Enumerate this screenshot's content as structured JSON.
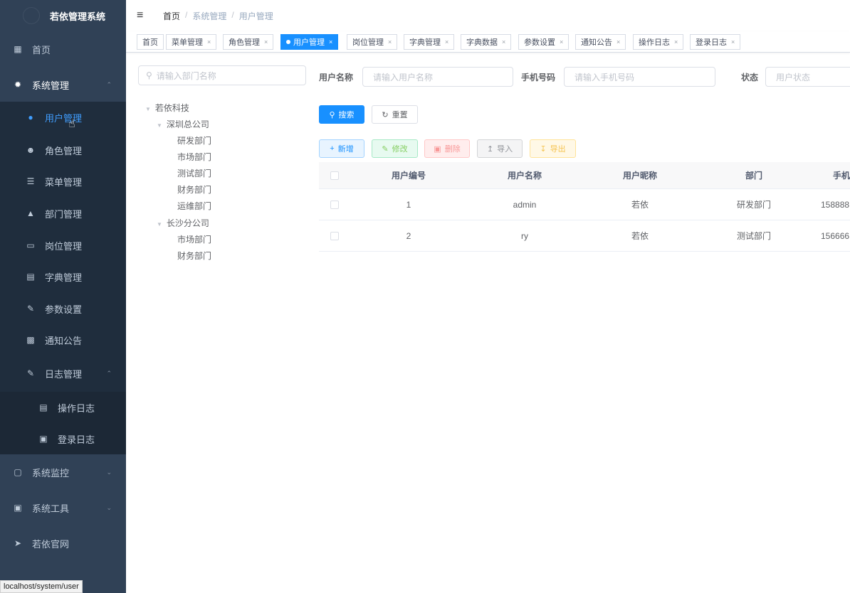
{
  "app": {
    "title": "若依管理系统"
  },
  "sidebar": {
    "items": [
      {
        "label": "首页",
        "icon": "dashboard-icon"
      },
      {
        "label": "系统管理",
        "icon": "gear-icon"
      },
      {
        "label": "用户管理",
        "icon": "user-icon"
      },
      {
        "label": "角色管理",
        "icon": "peoples-icon"
      },
      {
        "label": "菜单管理",
        "icon": "tree-table-icon"
      },
      {
        "label": "部门管理",
        "icon": "tree-icon"
      },
      {
        "label": "岗位管理",
        "icon": "post-icon"
      },
      {
        "label": "字典管理",
        "icon": "dict-icon"
      },
      {
        "label": "参数设置",
        "icon": "edit-icon"
      },
      {
        "label": "通知公告",
        "icon": "message-icon"
      },
      {
        "label": "日志管理",
        "icon": "log-icon"
      },
      {
        "label": "操作日志",
        "icon": "form-icon"
      },
      {
        "label": "登录日志",
        "icon": "logininfor-icon"
      },
      {
        "label": "系统监控",
        "icon": "monitor-icon"
      },
      {
        "label": "系统工具",
        "icon": "tool-icon"
      },
      {
        "label": "若依官网",
        "icon": "guide-icon"
      }
    ]
  },
  "breadcrumb": [
    "首页",
    "系统管理",
    "用户管理"
  ],
  "tags": [
    "首页",
    "菜单管理",
    "角色管理",
    "用户管理",
    "岗位管理",
    "字典管理",
    "字典数据",
    "参数设置",
    "通知公告",
    "操作日志",
    "登录日志"
  ],
  "dept": {
    "search_placeholder": "请输入部门名称",
    "tree": [
      "若依科技",
      "深圳总公司",
      "研发部门",
      "市场部门",
      "测试部门",
      "财务部门",
      "运维部门",
      "长沙分公司",
      "市场部门",
      "财务部门"
    ]
  },
  "form": {
    "username_label": "用户名称",
    "username_placeholder": "请输入用户名称",
    "phone_label": "手机号码",
    "phone_placeholder": "请输入手机号码",
    "status_label": "状态",
    "status_placeholder": "用户状态"
  },
  "buttons": {
    "search": "搜索",
    "reset": "重置",
    "add": "新增",
    "edit": "修改",
    "delete": "删除",
    "import": "导入",
    "export": "导出"
  },
  "table": {
    "headers": [
      "用户编号",
      "用户名称",
      "用户昵称",
      "部门",
      "手机"
    ],
    "rows": [
      [
        "1",
        "admin",
        "若依",
        "研发部门",
        "158888"
      ],
      [
        "2",
        "ry",
        "若依",
        "测试部门",
        "156666"
      ]
    ]
  },
  "status_url": "localhost/system/user",
  "colors": {
    "sidebar": "#304156",
    "submenu": "#1f2d3d",
    "primary": "#1890ff"
  }
}
